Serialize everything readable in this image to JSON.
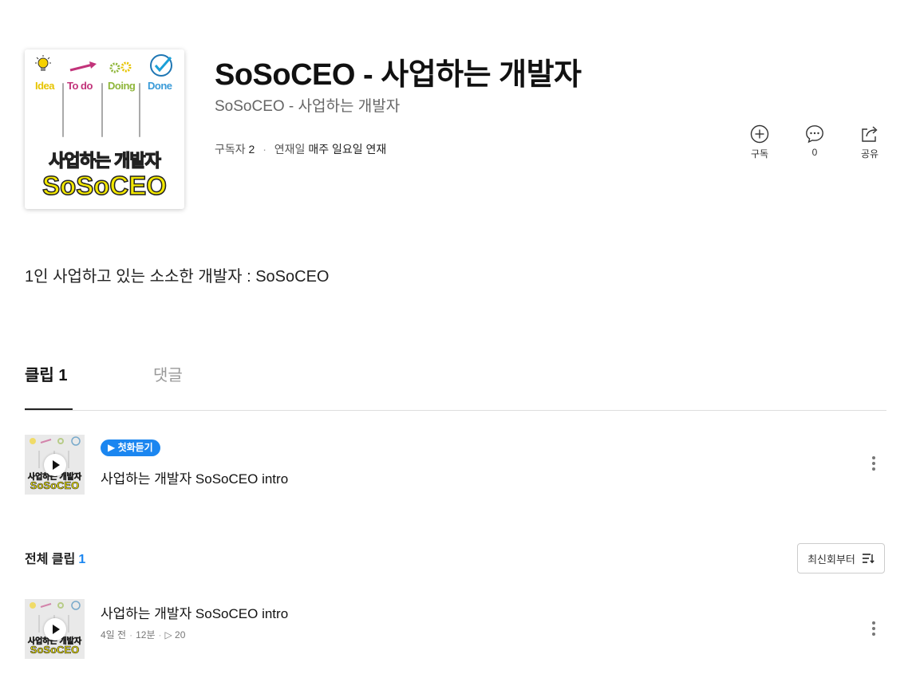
{
  "channel": {
    "cover": {
      "labels": [
        "Idea",
        "To do",
        "Doing",
        "Done"
      ],
      "label_colors": [
        "#e7c400",
        "#c2337a",
        "#8fb63a",
        "#3a9bd8"
      ],
      "headline": "사업하는 개발자",
      "brand": "SoSoCEO"
    },
    "title": "SoSoCEO - 사업하는 개발자",
    "subtitle": "SoSoCEO - 사업하는 개발자",
    "subscribers_label": "구독자",
    "subscribers_count": "2",
    "schedule_label": "연재일",
    "schedule_value": "매주 일요일 연재",
    "description": "1인 사업하고 있는 소소한 개발자 : SoSoCEO"
  },
  "actions": {
    "subscribe_label": "구독",
    "comment_count": "0",
    "share_label": "공유"
  },
  "tabs": [
    {
      "label": "클립 1",
      "active": true
    },
    {
      "label": "댓글",
      "active": false
    }
  ],
  "first_episode": {
    "badge": "▶ 첫화듣기",
    "title": "사업하는 개발자 SoSoCEO intro"
  },
  "all_clips": {
    "heading": "전체 클립",
    "count": "1",
    "sort_label": "최신회부터"
  },
  "episodes": [
    {
      "title": "사업하는 개발자 SoSoCEO intro",
      "age": "4일 전",
      "duration": "12분",
      "plays": "▷ 20"
    }
  ],
  "colors": {
    "accent": "#1b86f0",
    "cover_text": "#f3e800"
  }
}
